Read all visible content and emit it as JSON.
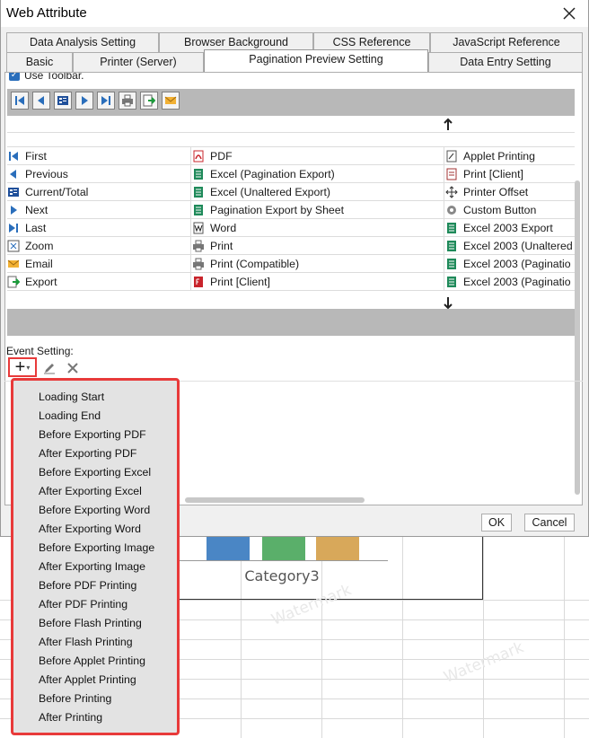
{
  "window": {
    "title": "Web Attribute"
  },
  "tabs_row1": [
    {
      "label": "Data Analysis Setting"
    },
    {
      "label": "Browser Background"
    },
    {
      "label": "CSS Reference"
    },
    {
      "label": "JavaScript Reference"
    }
  ],
  "tabs_row2": [
    {
      "label": "Basic"
    },
    {
      "label": "Printer (Server)"
    },
    {
      "label": "Pagination Preview Setting",
      "active": true
    },
    {
      "label": "Data Entry Setting"
    }
  ],
  "toolbar": {
    "use_toolbar_label": "Use Toolbar.",
    "icons": [
      "first-icon",
      "previous-icon",
      "current-total-icon",
      "next-icon",
      "last-icon",
      "print-icon",
      "export-icon",
      "email-icon"
    ]
  },
  "columns": {
    "col1": [
      {
        "label": "First",
        "icon": "first-icon"
      },
      {
        "label": "Previous",
        "icon": "previous-icon"
      },
      {
        "label": "Current/Total",
        "icon": "current-total-icon"
      },
      {
        "label": "Next",
        "icon": "next-icon"
      },
      {
        "label": "Last",
        "icon": "last-icon"
      },
      {
        "label": "Zoom",
        "icon": "zoom-icon"
      },
      {
        "label": "Email",
        "icon": "email-icon"
      },
      {
        "label": "Export",
        "icon": "export-icon"
      }
    ],
    "col2": [
      {
        "label": "PDF",
        "icon": "pdf-icon"
      },
      {
        "label": "Excel (Pagination Export)",
        "icon": "excel-icon"
      },
      {
        "label": "Excel (Unaltered Export)",
        "icon": "excel-icon"
      },
      {
        "label": "Pagination Export by Sheet",
        "icon": "excel-icon"
      },
      {
        "label": "Word",
        "icon": "word-icon"
      },
      {
        "label": "Print",
        "icon": "print-icon"
      },
      {
        "label": "Print (Compatible)",
        "icon": "print-icon"
      },
      {
        "label": "Print [Client]",
        "icon": "flash-print-icon"
      }
    ],
    "col3": [
      {
        "label": "Applet Printing",
        "icon": "applet-icon"
      },
      {
        "label": "Print [Client]",
        "icon": "client-print-icon"
      },
      {
        "label": "Printer Offset",
        "icon": "move-icon"
      },
      {
        "label": "Custom Button",
        "icon": "gear-icon"
      },
      {
        "label": "Excel 2003 Export",
        "icon": "excel-icon"
      },
      {
        "label": "Excel 2003 (Unaltered",
        "icon": "excel-icon"
      },
      {
        "label": "Excel 2003 (Paginatio",
        "icon": "excel-icon"
      },
      {
        "label": "Excel 2003 (Paginatio",
        "icon": "excel-icon"
      }
    ]
  },
  "event_setting": {
    "label": "Event Setting:",
    "add_symbol": "+",
    "dropdown_symbol": "▾"
  },
  "event_menu": [
    "Loading Start",
    "Loading End",
    "Before Exporting PDF",
    "After Exporting PDF",
    "Before Exporting Excel",
    "After Exporting Excel",
    "Before Exporting Word",
    "After Exporting Word",
    "Before Exporting Image",
    "After Exporting Image",
    "Before PDF Printing",
    "After PDF Printing",
    "Before Flash Printing",
    "After Flash Printing",
    "Before Applet Printing",
    "After Applet Printing",
    "Before Printing",
    "After Printing"
  ],
  "buttons": {
    "ok": "OK",
    "cancel": "Cancel"
  },
  "background": {
    "category_label": "Category3",
    "watermark": "Watermark",
    "bar_colors": [
      "#4a86c5",
      "#5aaf6a",
      "#d8a85a"
    ]
  }
}
